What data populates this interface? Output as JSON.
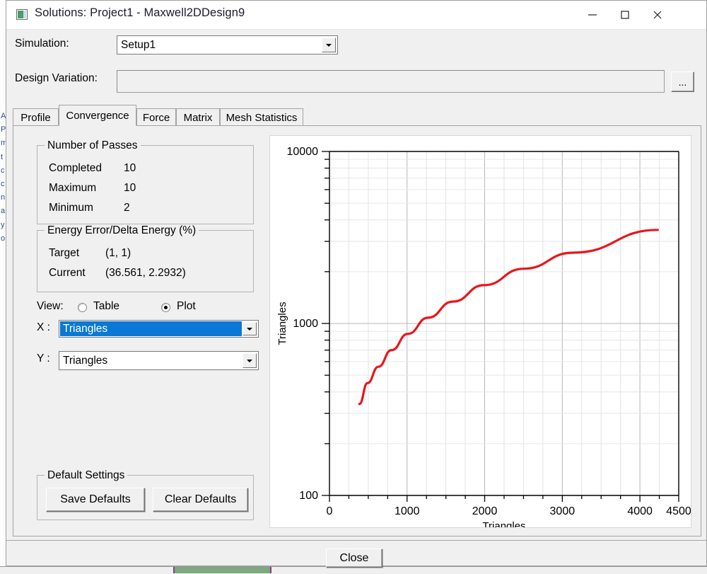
{
  "window": {
    "title": "Solutions: Project1 - Maxwell2DDesign9",
    "icon": "app-window-icon",
    "minimize": "minimize-icon",
    "maximize": "maximize-icon",
    "close": "close-icon"
  },
  "form": {
    "simulation_label": "Simulation:",
    "simulation_value": "Setup1",
    "design_variation_label": "Design Variation:",
    "design_variation_value": "",
    "browse_label": "..."
  },
  "tabs": [
    {
      "label": "Profile",
      "selected": false
    },
    {
      "label": "Convergence",
      "selected": true
    },
    {
      "label": "Force",
      "selected": false
    },
    {
      "label": "Matrix",
      "selected": false
    },
    {
      "label": "Mesh Statistics",
      "selected": false
    }
  ],
  "passes": {
    "title": "Number of Passes",
    "rows": [
      {
        "label": "Completed",
        "value": "10"
      },
      {
        "label": "Maximum",
        "value": "10"
      },
      {
        "label": "Minimum",
        "value": "2"
      }
    ]
  },
  "energy": {
    "title": "Energy Error/Delta Energy (%)",
    "rows": [
      {
        "label": "Target",
        "value": "(1, 1)"
      },
      {
        "label": "Current",
        "value": "(36.561, 2.2932)"
      }
    ]
  },
  "view": {
    "label": "View:",
    "table_label": "Table",
    "plot_label": "Plot",
    "selected": "Plot",
    "x_label": "X :",
    "x_value": "Triangles",
    "y_label": "Y :",
    "y_value": "Triangles",
    "highlight_color": "#0a78d4"
  },
  "defaults": {
    "title": "Default Settings",
    "save_label": "Save Defaults",
    "clear_label": "Clear Defaults"
  },
  "footer": {
    "close_label": "Close"
  },
  "chart_data": {
    "type": "line",
    "title": "",
    "xlabel": "Triangles",
    "ylabel": "Triangles",
    "xlim": [
      0,
      4500
    ],
    "ylim": [
      100,
      10000
    ],
    "yscale": "log",
    "xscale": "linear",
    "grid": true,
    "legend": false,
    "x_ticks": [
      0,
      1000,
      2000,
      3000,
      4000,
      4500
    ],
    "x_tick_labels": [
      "0",
      "1000",
      "2000",
      "3000",
      "4000",
      "4500"
    ],
    "x_minor_step": 250,
    "y_ticks": [
      100,
      1000,
      10000
    ],
    "y_tick_labels": [
      "100",
      "1000",
      "10000"
    ],
    "series": [
      {
        "name": "Triangles",
        "color": "#e8161b",
        "x": [
          385,
          490,
          630,
          800,
          1010,
          1270,
          1590,
          1990,
          2500,
          3140,
          4230
        ],
        "y": [
          340,
          450,
          560,
          700,
          870,
          1080,
          1340,
          1670,
          2080,
          2580,
          3500
        ]
      }
    ]
  }
}
